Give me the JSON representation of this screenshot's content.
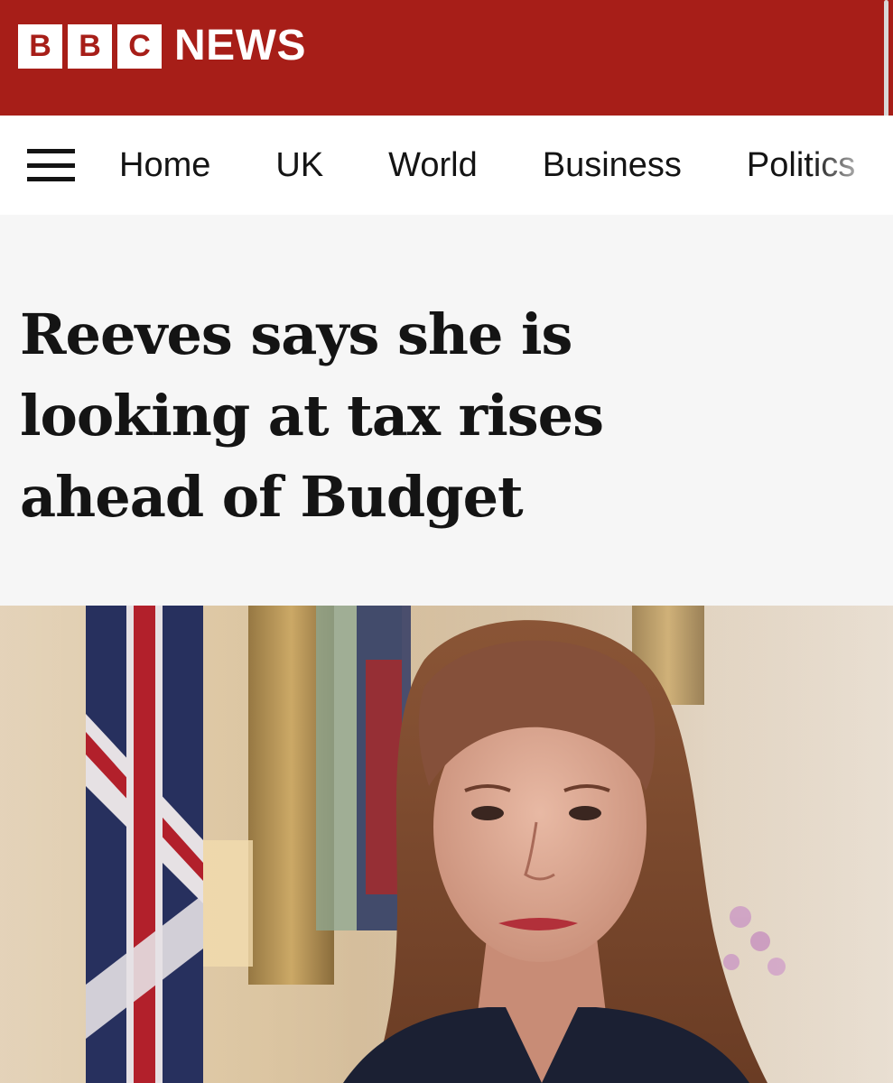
{
  "brand": {
    "blocks": [
      "B",
      "B",
      "C"
    ],
    "news_label": "NEWS",
    "header_color": "#a71e18"
  },
  "nav": {
    "menu_icon": "hamburger-menu-icon",
    "items": [
      "Home",
      "UK",
      "World",
      "Business",
      "Politics"
    ]
  },
  "article": {
    "headline_lines": [
      "Reeves says she is",
      "looking at tax rises",
      "ahead of Budget"
    ]
  }
}
